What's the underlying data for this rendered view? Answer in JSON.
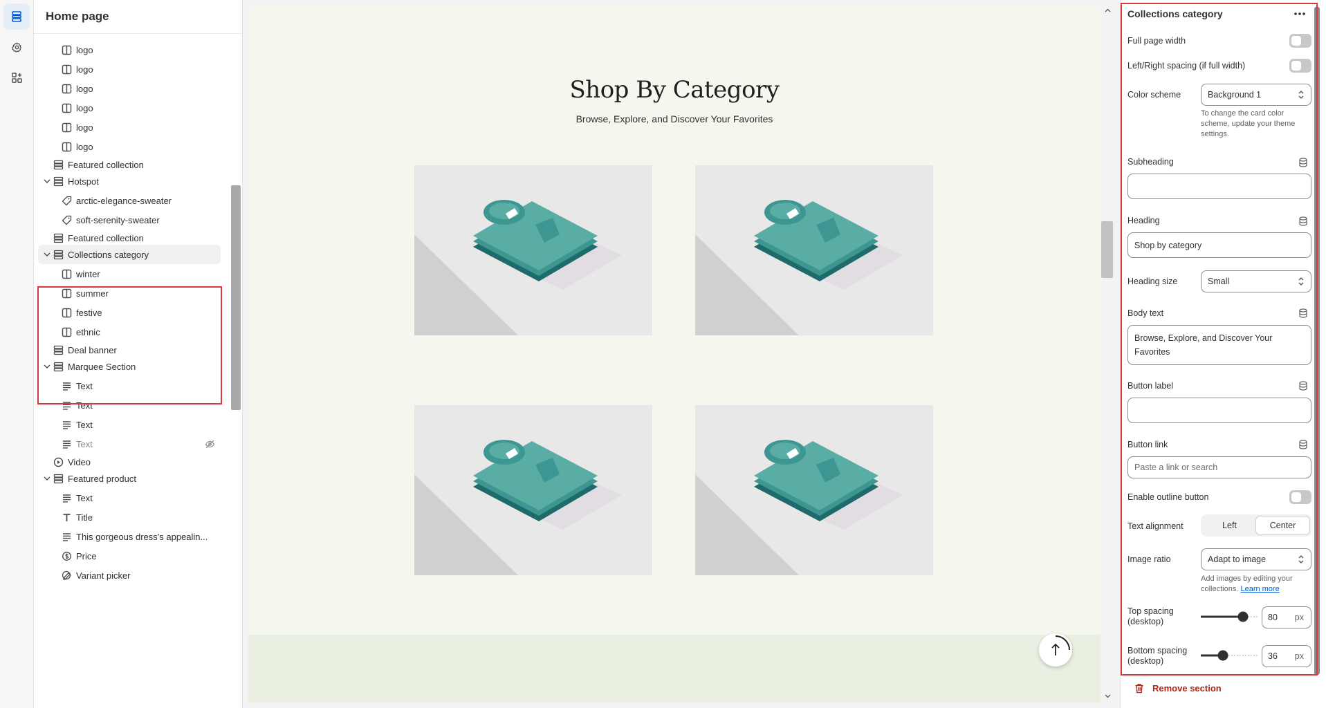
{
  "rail": {
    "items": [
      {
        "icon": "sections-icon",
        "active": true
      },
      {
        "icon": "gear-icon",
        "active": false
      },
      {
        "icon": "apps-icon",
        "active": false
      }
    ]
  },
  "tree": {
    "title": "Home page",
    "items": [
      {
        "label": "logo",
        "type": "block",
        "icon": "block-icon",
        "level": 2
      },
      {
        "label": "logo",
        "type": "block",
        "icon": "block-icon",
        "level": 2
      },
      {
        "label": "logo",
        "type": "block",
        "icon": "block-icon",
        "level": 2
      },
      {
        "label": "logo",
        "type": "block",
        "icon": "block-icon",
        "level": 2
      },
      {
        "label": "logo",
        "type": "block",
        "icon": "block-icon",
        "level": 2
      },
      {
        "label": "logo",
        "type": "block",
        "icon": "block-icon",
        "level": 2
      },
      {
        "label": "Featured collection",
        "type": "section",
        "icon": "section-icon",
        "level": 1
      },
      {
        "label": "Hotspot",
        "type": "section",
        "icon": "section-icon",
        "level": 1,
        "expanded": true
      },
      {
        "label": "arctic-elegance-sweater",
        "type": "block",
        "icon": "tag-icon",
        "level": 2
      },
      {
        "label": "soft-serenity-sweater",
        "type": "block",
        "icon": "tag-icon",
        "level": 2
      },
      {
        "label": "Featured collection",
        "type": "section",
        "icon": "section-icon",
        "level": 1
      },
      {
        "label": "Collections category",
        "type": "section",
        "icon": "section-icon",
        "level": 1,
        "expanded": true,
        "selected": true
      },
      {
        "label": "winter",
        "type": "block",
        "icon": "block-icon",
        "level": 2
      },
      {
        "label": "summer",
        "type": "block",
        "icon": "block-icon",
        "level": 2
      },
      {
        "label": "festive",
        "type": "block",
        "icon": "block-icon",
        "level": 2
      },
      {
        "label": "ethnic",
        "type": "block",
        "icon": "block-icon",
        "level": 2
      },
      {
        "label": "Deal banner",
        "type": "section",
        "icon": "section-icon",
        "level": 1
      },
      {
        "label": "Marquee Section",
        "type": "section",
        "icon": "section-icon",
        "level": 1,
        "expanded": true
      },
      {
        "label": "Text",
        "type": "block",
        "icon": "text-icon",
        "level": 2
      },
      {
        "label": "Text",
        "type": "block",
        "icon": "text-icon",
        "level": 2
      },
      {
        "label": "Text",
        "type": "block",
        "icon": "text-icon",
        "level": 2
      },
      {
        "label": "Text",
        "type": "block",
        "icon": "text-icon",
        "level": 2,
        "hidden": true
      },
      {
        "label": "Video",
        "type": "section",
        "icon": "play-icon",
        "level": 1
      },
      {
        "label": "Featured product",
        "type": "section",
        "icon": "section-icon",
        "level": 1,
        "expanded": true
      },
      {
        "label": "Text",
        "type": "block",
        "icon": "text-icon",
        "level": 2
      },
      {
        "label": "Title",
        "type": "block",
        "icon": "title-icon",
        "level": 2
      },
      {
        "label": "This gorgeous dress's appealin...",
        "type": "block",
        "icon": "text-icon",
        "level": 2
      },
      {
        "label": "Price",
        "type": "block",
        "icon": "price-icon",
        "level": 2
      },
      {
        "label": "Variant picker",
        "type": "block",
        "icon": "variant-icon",
        "level": 2
      }
    ]
  },
  "preview": {
    "heading": "Shop By Category",
    "subheading": "Browse, Explore, and Discover Your Favorites",
    "card_count": 4
  },
  "settings": {
    "title": "Collections category",
    "full_page_width": {
      "label": "Full page width",
      "on": false
    },
    "lr_spacing": {
      "label": "Left/Right spacing (if full width)",
      "on": false
    },
    "color_scheme": {
      "label": "Color scheme",
      "value": "Background 1",
      "help": "To change the card color scheme, update your theme settings."
    },
    "subheading": {
      "label": "Subheading",
      "value": ""
    },
    "heading": {
      "label": "Heading",
      "value": "Shop by category"
    },
    "heading_size": {
      "label": "Heading size",
      "value": "Small"
    },
    "body_text": {
      "label": "Body text",
      "value": "Browse, Explore, and Discover Your Favorites"
    },
    "button_label": {
      "label": "Button label",
      "value": ""
    },
    "button_link": {
      "label": "Button link",
      "placeholder": "Paste a link or search"
    },
    "outline_button": {
      "label": "Enable outline button",
      "on": false
    },
    "text_alignment": {
      "label": "Text alignment",
      "options": [
        "Left",
        "Center"
      ],
      "selected": "Center"
    },
    "image_ratio": {
      "label": "Image ratio",
      "value": "Adapt to image",
      "help": "Add images by editing your collections.",
      "help_link": "Learn more"
    },
    "top_spacing": {
      "label": "Top spacing (desktop)",
      "value": "80",
      "unit": "px",
      "fraction": 0.8
    },
    "bottom_spacing": {
      "label": "Bottom spacing (desktop)",
      "value": "36",
      "unit": "px",
      "fraction": 0.36
    },
    "remove_label": "Remove section"
  },
  "colors": {
    "accent": "#d9383c",
    "teal": "#5aada4",
    "remove": "#b42318"
  }
}
